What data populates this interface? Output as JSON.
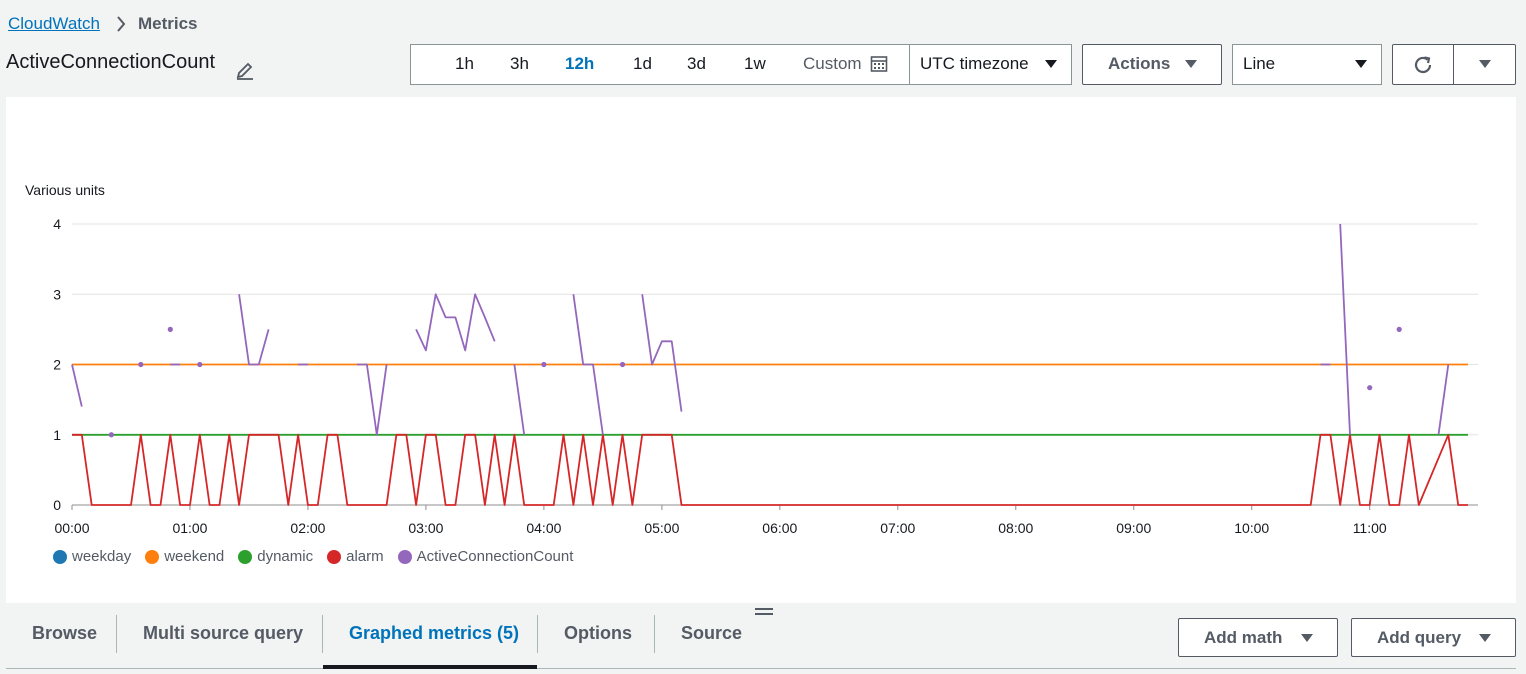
{
  "breadcrumb": {
    "root": "CloudWatch",
    "current": "Metrics"
  },
  "title": "ActiveConnectionCount",
  "time_range": {
    "options": [
      "1h",
      "3h",
      "12h",
      "1d",
      "3d",
      "1w"
    ],
    "active": "12h",
    "custom_label": "Custom"
  },
  "timezone": "UTC timezone",
  "actions_label": "Actions",
  "graph_type": "Line",
  "tabs": [
    {
      "label": "Browse",
      "active": false
    },
    {
      "label": "Multi source query",
      "active": false
    },
    {
      "label": "Graphed metrics (5)",
      "active": true
    },
    {
      "label": "Options",
      "active": false
    },
    {
      "label": "Source",
      "active": false
    }
  ],
  "add_math_label": "Add math",
  "add_query_label": "Add query",
  "chart_data": {
    "type": "line",
    "ylabel": "Various units",
    "ylim": [
      0,
      4
    ],
    "yticks": [
      0,
      1,
      2,
      3,
      4
    ],
    "xlim": [
      "00:00",
      "11:50"
    ],
    "xticks": [
      "00:00",
      "01:00",
      "02:00",
      "03:00",
      "04:00",
      "05:00",
      "06:00",
      "07:00",
      "08:00",
      "09:00",
      "10:00",
      "11:00"
    ],
    "grid": true,
    "legend_position": "bottom-left",
    "series": [
      {
        "name": "weekday",
        "color": "#1f77b4",
        "points": []
      },
      {
        "name": "weekend",
        "color": "#ff7f0e",
        "points": [
          [
            "00:00",
            2
          ],
          [
            "11:50",
            2
          ]
        ]
      },
      {
        "name": "dynamic",
        "color": "#2ca02c",
        "points": [
          [
            "00:00",
            1
          ],
          [
            "11:50",
            1
          ]
        ]
      },
      {
        "name": "alarm",
        "color": "#d62728",
        "points": [
          [
            "00:00",
            1
          ],
          [
            "00:05",
            1
          ],
          [
            "00:10",
            0
          ],
          [
            "00:30",
            0
          ],
          [
            "00:35",
            1
          ],
          [
            "00:40",
            0
          ],
          [
            "00:45",
            0
          ],
          [
            "00:50",
            1
          ],
          [
            "00:55",
            0
          ],
          [
            "01:00",
            0
          ],
          [
            "01:05",
            1
          ],
          [
            "01:10",
            0
          ],
          [
            "01:15",
            0
          ],
          [
            "01:20",
            1
          ],
          [
            "01:25",
            0
          ],
          [
            "01:30",
            1
          ],
          [
            "01:45",
            1
          ],
          [
            "01:50",
            0
          ],
          [
            "01:55",
            1
          ],
          [
            "02:00",
            0
          ],
          [
            "02:05",
            0
          ],
          [
            "02:10",
            1
          ],
          [
            "02:15",
            1
          ],
          [
            "02:20",
            0
          ],
          [
            "02:40",
            0
          ],
          [
            "02:45",
            1
          ],
          [
            "02:50",
            1
          ],
          [
            "02:55",
            0
          ],
          [
            "03:00",
            1
          ],
          [
            "03:05",
            1
          ],
          [
            "03:10",
            0
          ],
          [
            "03:15",
            0
          ],
          [
            "03:20",
            1
          ],
          [
            "03:25",
            1
          ],
          [
            "03:30",
            0
          ],
          [
            "03:35",
            1
          ],
          [
            "03:40",
            0
          ],
          [
            "03:45",
            1
          ],
          [
            "03:50",
            0
          ],
          [
            "04:05",
            0
          ],
          [
            "04:10",
            1
          ],
          [
            "04:15",
            0
          ],
          [
            "04:20",
            1
          ],
          [
            "04:25",
            0
          ],
          [
            "04:30",
            1
          ],
          [
            "04:35",
            0
          ],
          [
            "04:40",
            1
          ],
          [
            "04:45",
            0
          ],
          [
            "04:50",
            1
          ],
          [
            "05:05",
            1
          ],
          [
            "05:10",
            0
          ],
          [
            "10:30",
            0
          ],
          [
            "10:35",
            1
          ],
          [
            "10:40",
            1
          ],
          [
            "10:45",
            0
          ],
          [
            "10:50",
            1
          ],
          [
            "10:55",
            0
          ],
          [
            "11:00",
            0
          ],
          [
            "11:05",
            1
          ],
          [
            "11:10",
            0
          ],
          [
            "11:15",
            0
          ],
          [
            "11:20",
            1
          ],
          [
            "11:25",
            0
          ],
          [
            "11:40",
            1
          ],
          [
            "11:45",
            0
          ],
          [
            "11:50",
            0
          ]
        ]
      },
      {
        "name": "ActiveConnectionCount",
        "color": "#9467bd",
        "segments": [
          [
            [
              "00:00",
              2
            ],
            [
              "00:05",
              1.4
            ]
          ],
          [
            [
              "00:50",
              2
            ],
            [
              "00:55",
              2
            ]
          ],
          [
            [
              "01:25",
              3
            ],
            [
              "01:30",
              2
            ],
            [
              "01:35",
              2
            ],
            [
              "01:40",
              2.5
            ]
          ],
          [
            [
              "01:55",
              2
            ],
            [
              "02:00",
              2
            ]
          ],
          [
            [
              "02:25",
              2
            ],
            [
              "02:30",
              2
            ],
            [
              "02:35",
              1
            ],
            [
              "02:40",
              2
            ]
          ],
          [
            [
              "02:55",
              2.5
            ],
            [
              "03:00",
              2.2
            ],
            [
              "03:05",
              3
            ],
            [
              "03:10",
              2.67
            ],
            [
              "03:15",
              2.67
            ],
            [
              "03:20",
              2.2
            ],
            [
              "03:25",
              3
            ],
            [
              "03:30",
              2.67
            ],
            [
              "03:35",
              2.33
            ]
          ],
          [
            [
              "03:45",
              2
            ],
            [
              "03:50",
              1
            ]
          ],
          [
            [
              "04:15",
              3
            ],
            [
              "04:20",
              2
            ],
            [
              "04:25",
              2
            ],
            [
              "04:30",
              1
            ]
          ],
          [
            [
              "04:50",
              3
            ],
            [
              "04:55",
              2
            ],
            [
              "05:00",
              2.33
            ],
            [
              "05:05",
              2.33
            ],
            [
              "05:10",
              1.33
            ]
          ],
          [
            [
              "10:35",
              2
            ],
            [
              "10:40",
              2
            ]
          ],
          [
            [
              "10:45",
              4
            ],
            [
              "10:50",
              1
            ]
          ],
          [
            [
              "11:35",
              1
            ],
            [
              "11:40",
              2
            ]
          ]
        ],
        "dots": [
          [
            "00:20",
            1
          ],
          [
            "00:35",
            2
          ],
          [
            "00:50",
            2.5
          ],
          [
            "01:05",
            2
          ],
          [
            "04:00",
            2
          ],
          [
            "04:40",
            2
          ],
          [
            "11:00",
            1.67
          ],
          [
            "11:15",
            2.5
          ]
        ]
      }
    ]
  }
}
